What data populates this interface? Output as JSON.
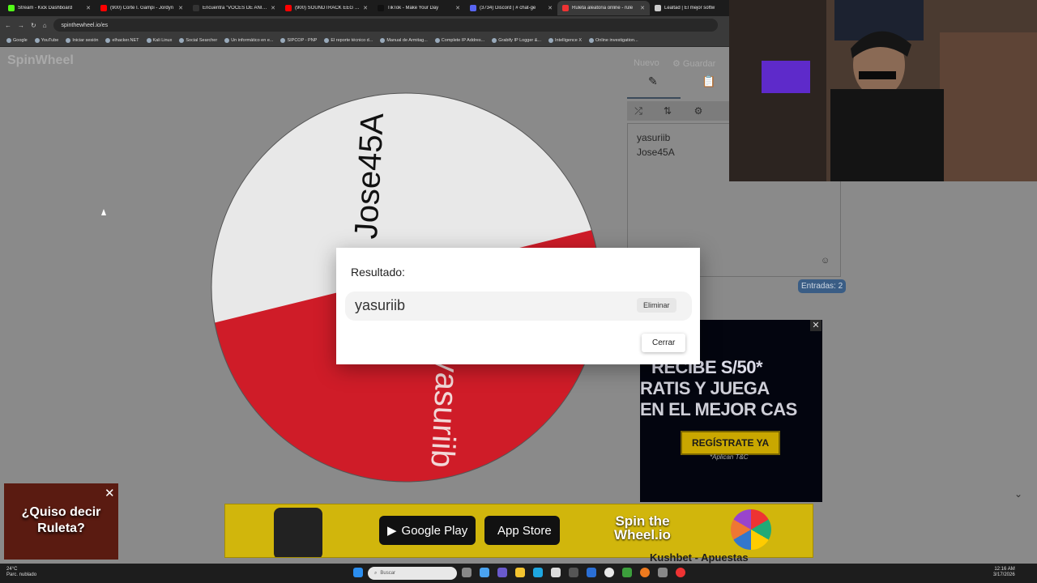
{
  "browser": {
    "tabs": [
      {
        "title": "Stream - Kick Dashboard",
        "color": "#53fc18",
        "active": false
      },
      {
        "title": "(900) Corte I. Gampi - Jordyn",
        "color": "#ff0000",
        "active": false
      },
      {
        "title": "Encuentra \"VOCES DE ANIMV",
        "color": "#333333",
        "active": false
      },
      {
        "title": "(900) SOUNDTRACK EEG | CO",
        "color": "#ff0000",
        "active": false
      },
      {
        "title": "TikTok - Make Your Day",
        "color": "#111111",
        "active": false
      },
      {
        "title": "(3734) Discord | # chat-ge",
        "color": "#5865f2",
        "active": false
      },
      {
        "title": "Ruleta aleatoria online - rule",
        "color": "#e33",
        "active": true
      },
      {
        "title": "Lealtad | El mejor softw",
        "color": "#cccccc",
        "active": false
      }
    ],
    "url": "spinthewheel.io/es",
    "bookmarks": [
      "Google",
      "YouTube",
      "Iniciar sesión",
      "elhacker.NET",
      "Kali Linux",
      "Social Searcher",
      "Un informático en e...",
      "SIPCOP - PNP",
      "El reporte técnico d...",
      "Manual de Armitag...",
      "Complete IP Addres...",
      "Grabify IP Logger &...",
      "Intelligence X",
      "Online investigation..."
    ]
  },
  "app": {
    "logo": "SpinWheel",
    "new_label": "Nuevo",
    "save_label": "Guardar",
    "entries": [
      "yasuriib",
      "Jose45A"
    ],
    "entries_count": "Entradas: 2",
    "wheel": {
      "segments": [
        {
          "label": "Jose45A",
          "color": "#e8e8e8"
        },
        {
          "label": "yasuriib",
          "color": "#cf1c28"
        }
      ]
    }
  },
  "modal": {
    "title": "Resultado:",
    "result": "yasuriib",
    "remove_label": "Eliminar",
    "close_label": "Cerrar"
  },
  "ads": {
    "right": {
      "line1": "RECIBE S/50*",
      "line2": "RATIS Y JUEGA",
      "line3": "EN EL MEJOR CAS",
      "cta": "REGÍSTRATE YA",
      "terms": "*Aplican T&C"
    },
    "banner": {
      "google_play": "Google Play",
      "app_store": "App Store",
      "brand": "Spin the Wheel.io"
    },
    "popup": {
      "text": "¿Quiso decir Ruleta?"
    },
    "under_text": "Kushbet - Apuestas"
  },
  "taskbar": {
    "weather_temp": "24°C",
    "weather_desc": "Parc. nublado",
    "search_placeholder": "Buscar",
    "time": "12:16 AM",
    "date": "3/17/2026"
  }
}
